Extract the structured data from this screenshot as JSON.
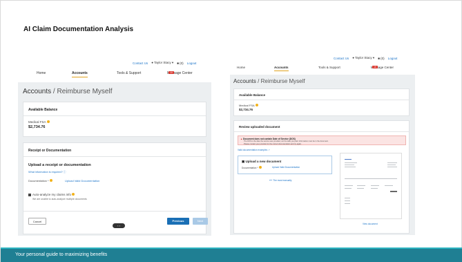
{
  "slide": {
    "title": "AI Claim Documentation Analysis",
    "footer": "Your personal guide to maximizing benefits"
  },
  "colors": {
    "accent_teal": "#1f7f93",
    "link_blue": "#1a73c8",
    "nav_underline": "#e1a21e",
    "badge_red": "#d9342b",
    "alert_bg": "#fbe4e3"
  },
  "left": {
    "util": {
      "contact": "Contact Us",
      "user": "Taylor Stacy",
      "cart": "(0)",
      "logout": "Logout"
    },
    "nav": {
      "home": "Home",
      "accounts": "Accounts",
      "tools": "Tools & Support",
      "messages": "Message Center",
      "badge": "10"
    },
    "page_title_main": "Accounts",
    "page_title_sub": "/ Reimburse Myself",
    "balance": {
      "heading": "Available Balance",
      "account": "Medical FSA",
      "amount": "$2,734.76"
    },
    "receipt": {
      "heading": "Receipt or Documentation",
      "upload_heading": "Upload a receipt or documentation",
      "what_info": "What information is required?",
      "doc_label": "Documentation *",
      "upload_link": "Upload Valid Documentation",
      "auto_label": "Auto-analyze my claims info",
      "auto_note": "We are unable to auto-analyze multiple documents"
    },
    "buttons": {
      "cancel": "Cancel",
      "previous": "Previous",
      "next": "Next"
    }
  },
  "right": {
    "util": {
      "contact": "Contact Us",
      "user": "Taylor Stacy",
      "cart": "(0)",
      "logout": "Logout"
    },
    "nav": {
      "home": "Home",
      "accounts": "Accounts",
      "tools": "Tools & Support",
      "messages": "Message Center",
      "badge": "10"
    },
    "page_title_main": "Accounts",
    "page_title_sub": "/ Reimburse Myself",
    "balance": {
      "heading": "Available Balance",
      "account": "Medical FSA",
      "amount": "$2,734.76"
    },
    "review": {
      "heading": "Review uploaded document",
      "alert_title": "Document does not contain Date of Service (DOS)",
      "alert_body_1": "The DOS is the date the service was provided, not the date you paid. Information must be in the document.",
      "alert_body_2": "Please contact your provider for the correct documentation and try again.",
      "need_help": "Valid documentation examples",
      "upload_new": "Upload a new document",
      "doc_label": "Documentation *",
      "upload_link": "Upload Valid Documentation",
      "prev_link": "The most manually",
      "view_doc": "View document"
    }
  }
}
